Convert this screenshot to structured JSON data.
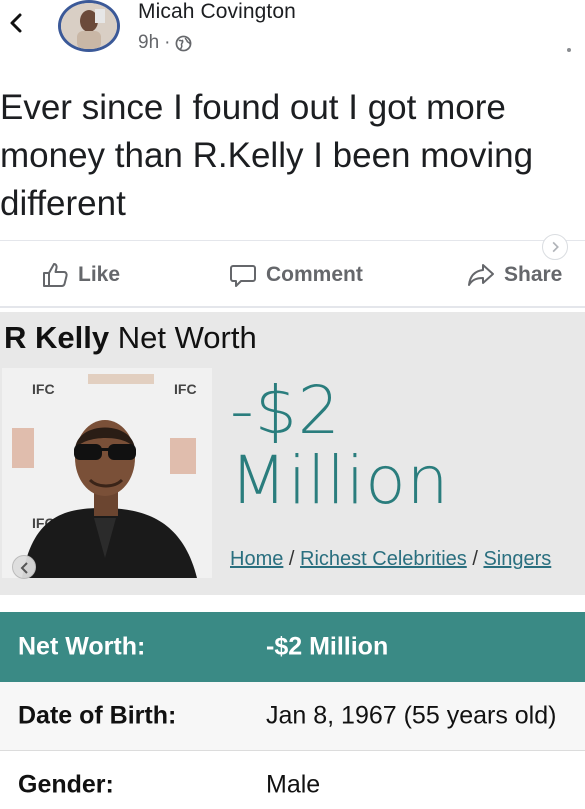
{
  "post": {
    "author": "Micah Covington",
    "time": "9h",
    "separator": "·",
    "text": "Ever since I found out I got more money than R.Kelly I been moving different",
    "actions": {
      "like": "Like",
      "comment": "Comment",
      "share": "Share"
    },
    "icons": [
      "back-arrow-icon",
      "globe-icon",
      "like-icon",
      "comment-icon",
      "share-icon",
      "chevron-right-icon"
    ]
  },
  "celebrity": {
    "title_bold": "R Kelly",
    "title_rest": "Net Worth",
    "worth_line1": "-$2",
    "worth_line2": "Million",
    "breadcrumb": {
      "home": "Home",
      "sep": "/",
      "richest": "Richest Celebrities",
      "singers": "Singers"
    },
    "photo_backdrop_text": [
      "IFC",
      "IFC",
      "IFC"
    ],
    "accent_color": "#2a7d7d"
  },
  "table": {
    "rows": [
      {
        "key": "Net Worth:",
        "value": "-$2 Million"
      },
      {
        "key": "Date of Birth:",
        "value": "Jan 8, 1967 (55 years old)"
      },
      {
        "key": "Gender:",
        "value": "Male"
      }
    ],
    "header_color": "#3a8a85"
  }
}
